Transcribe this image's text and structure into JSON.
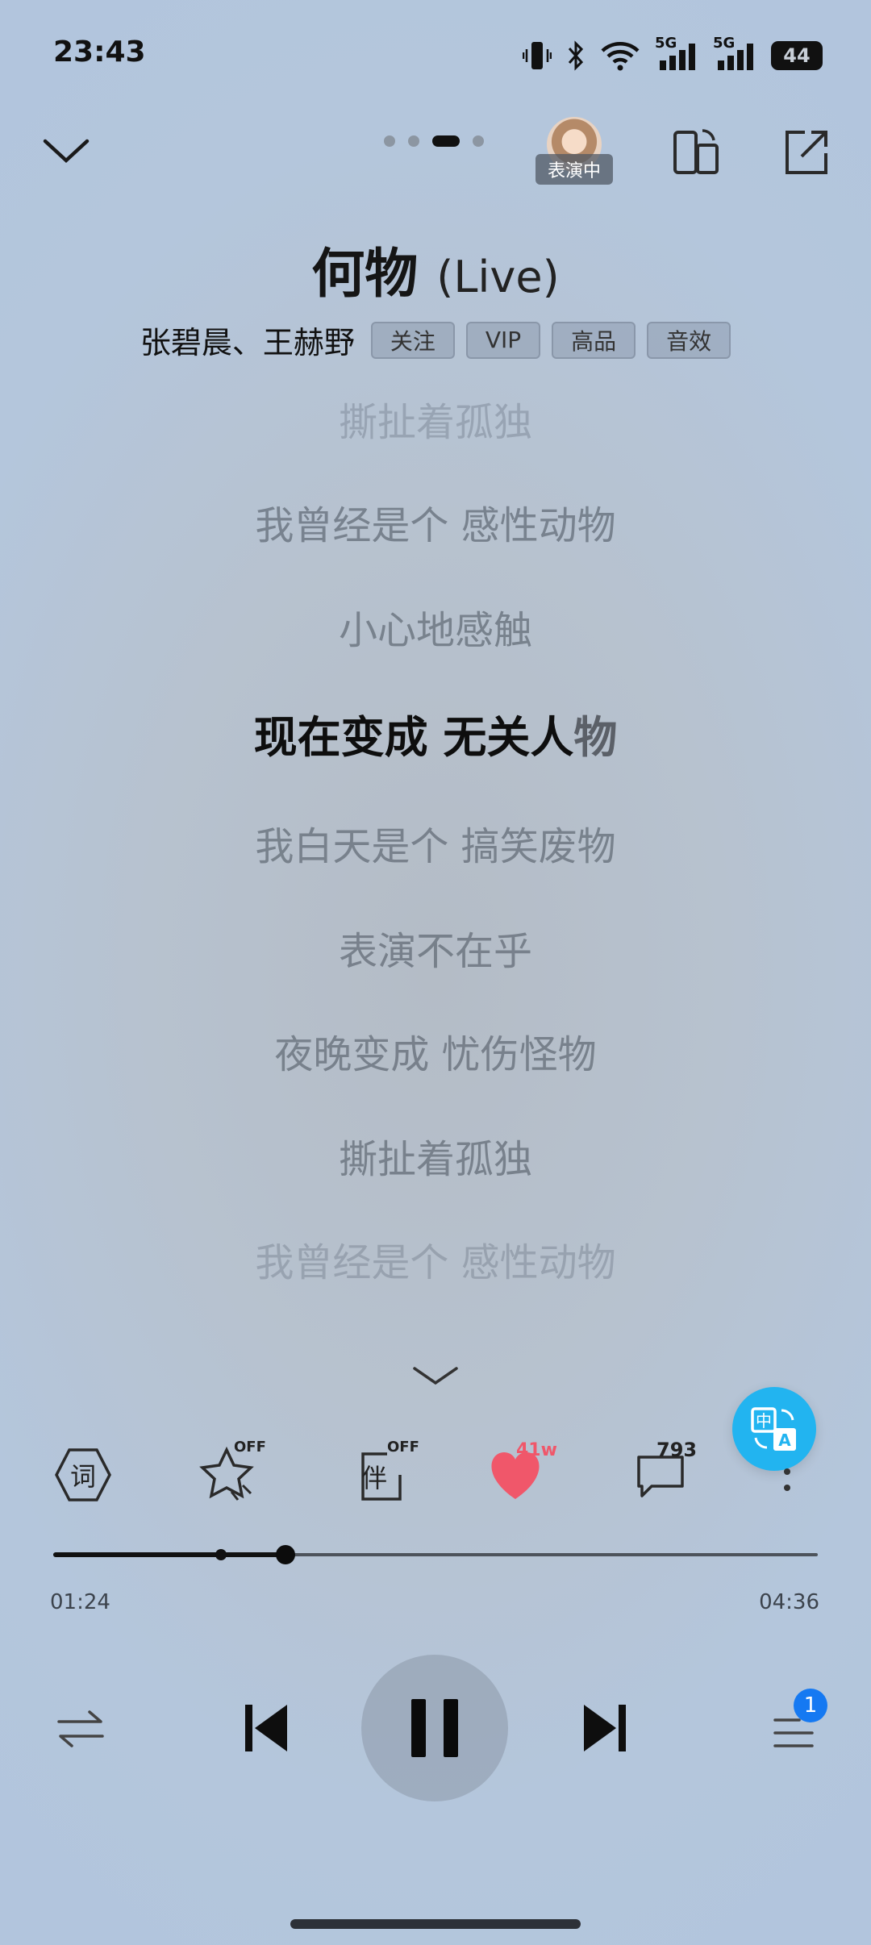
{
  "status_bar": {
    "time": "23:43",
    "battery": "44",
    "network_1": "5G",
    "network_2": "5G"
  },
  "header": {
    "performance_badge": "表演中",
    "page_dots_count": 4,
    "active_dot": 3
  },
  "song": {
    "title": "何物",
    "title_suffix": "(Live)",
    "artists": "张碧晨、王赫野",
    "tags": [
      "关注",
      "VIP",
      "高品",
      "音效"
    ]
  },
  "lyrics": {
    "faded_top": "撕扯着孤独",
    "lines_before": [
      "我曾经是个 感性动物",
      "小心地感触"
    ],
    "current_sung": "现在变成 无关人",
    "current_rest": "物",
    "lines_after": [
      "我白天是个 搞笑废物",
      "表演不在乎",
      "夜晚变成 忧伤怪物",
      "撕扯着孤独"
    ],
    "faded_bottom": "我曾经是个 感性动物"
  },
  "actions": {
    "lyrics_icon_char": "词",
    "favorite_state": "OFF",
    "accompany_char": "伴",
    "accompany_state": "OFF",
    "like_count": "41w",
    "comment_count": "793"
  },
  "playback": {
    "elapsed": "01:24",
    "duration": "04:36",
    "progress_fraction": 0.3
  },
  "queue": {
    "badge_count": "1"
  },
  "colors": {
    "accent_like": "#f0576a",
    "translate_button": "#22b4f0",
    "queue_badge": "#1579f2"
  }
}
